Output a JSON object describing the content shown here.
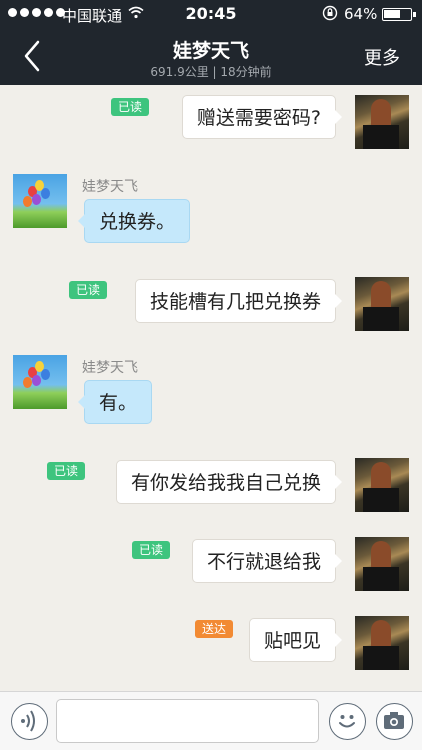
{
  "status_bar": {
    "carrier": "中国联通",
    "time": "20:45",
    "battery_text": "64%",
    "battery_level": 0.64,
    "signal_icon": "signal-dots-icon",
    "wifi_icon": "wifi-icon",
    "lock_icon": "rotation-lock-icon"
  },
  "navbar": {
    "title": "娃梦天飞",
    "subtitle": "691.9公里 | 18分钟前",
    "more_label": "更多",
    "back_icon": "chevron-left-icon"
  },
  "messages": [
    {
      "side": "out",
      "text": "赠送需要密码?",
      "status": "已读"
    },
    {
      "side": "in",
      "sender": "娃梦天飞",
      "text": "兑换券。"
    },
    {
      "side": "out",
      "text": "技能槽有几把兑换券",
      "status": "已读"
    },
    {
      "side": "in",
      "sender": "娃梦天飞",
      "text": "有。"
    },
    {
      "side": "out",
      "text": "有你发给我我自己兑换",
      "status": "已读"
    },
    {
      "side": "out",
      "text": "不行就退给我",
      "status": "已读"
    },
    {
      "side": "out",
      "text": "贴吧见",
      "status": "送达"
    }
  ],
  "input_bar": {
    "voice_icon": "voice-icon",
    "text_value": "",
    "emoji_icon": "emoji-icon",
    "camera_icon": "camera-icon"
  },
  "colors": {
    "nav_background": "#20262d",
    "chat_background": "#f1efea",
    "incoming_bubble": "#c5e8fb",
    "read_badge": "#3ec47e",
    "delivered_badge": "#f28a33"
  }
}
